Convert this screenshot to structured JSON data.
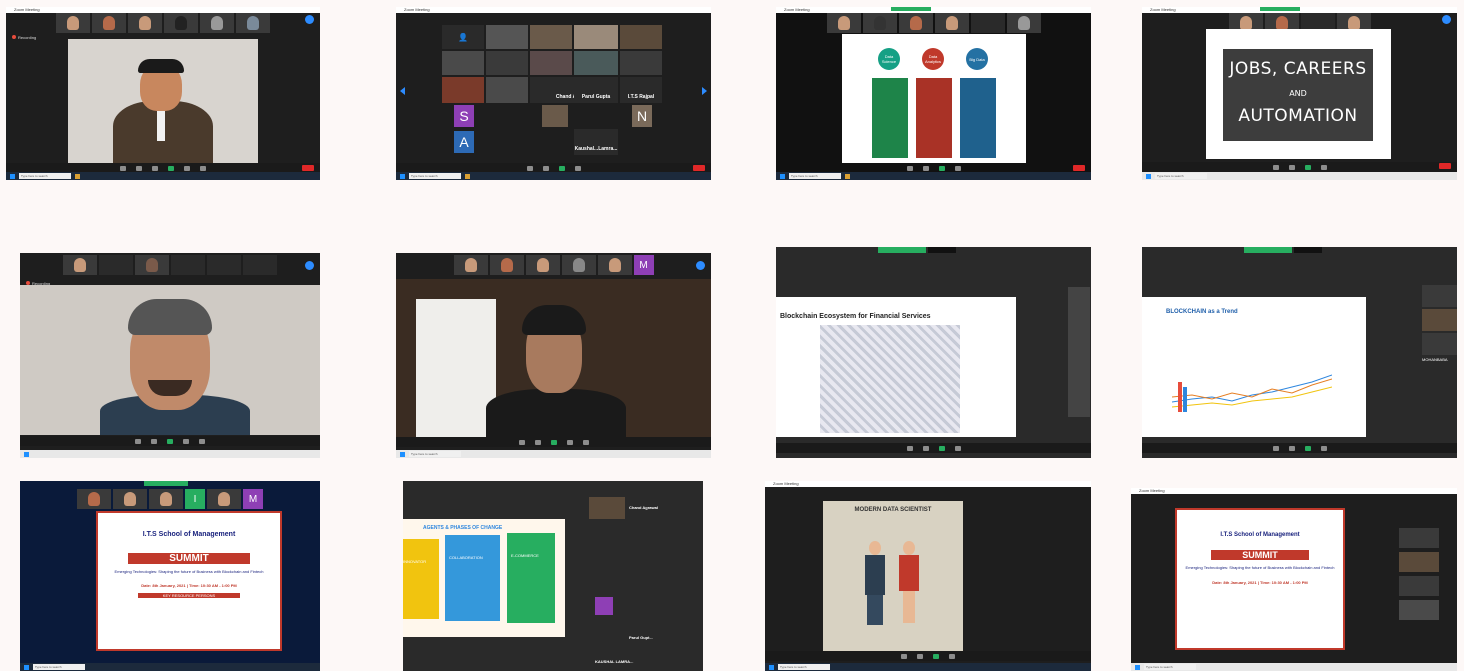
{
  "meeting": {
    "window_title": "Zoom Meeting",
    "recording": "Recording",
    "taskbar_search": "Type here to search",
    "view_options": "View Options"
  },
  "grid_names": {
    "n1": "Chand Agrawal",
    "n2": "Parul Gupta",
    "n3": "I.T.S Rajpal",
    "n4": "Kaushal...Lamra...",
    "s": "S",
    "a": "A",
    "n": "N",
    "m": "M",
    "i": "I"
  },
  "jobs_slide": {
    "line1": "JOBS, CAREERS",
    "line2": "AND",
    "line3": "AUTOMATION"
  },
  "data_circles": {
    "c1": "Data Science",
    "c2": "Data Analytics",
    "c3": "Big Data"
  },
  "blockchain": {
    "title": "Blockchain Ecosystem for Financial Services"
  },
  "blockchain_trend": {
    "title": "BLOCKCHAIN as a Trend"
  },
  "summit": {
    "school": "I.T.S School of Management",
    "place": "Mohan Nagar, Ghaziabad",
    "virtual": "VIRTUAL",
    "summit": "SUMMIT",
    "theme": "Emerging Technologies: Shaping the future of Business with Blockchain and Fintech",
    "date": "Date: 8th January, 2021 | Time: 10:30 AM - 1:00 PM",
    "key": "KEY RESOURCE PERSONS"
  },
  "change_slide": {
    "title": "AGENTS & PHASES OF CHANGE",
    "p1": "INNOVATOR",
    "p2": "COLLABORATION",
    "p3": "E-COMMERCE"
  },
  "mds": {
    "title": "MODERN DATA SCIENTIST"
  },
  "side_names": {
    "chand": "Chand Agrawal",
    "parul": "Parul Gupt...",
    "kaushal": "KAUSHAL LAMRA...",
    "akhil": "Akhil",
    "mohanbaba": "MOHANBABA",
    "satisfaction": "SATISFACTION"
  },
  "colors": {
    "zoom_blue": "#2d8cff",
    "end_red": "#e02828",
    "summit_red": "#c0392b"
  }
}
